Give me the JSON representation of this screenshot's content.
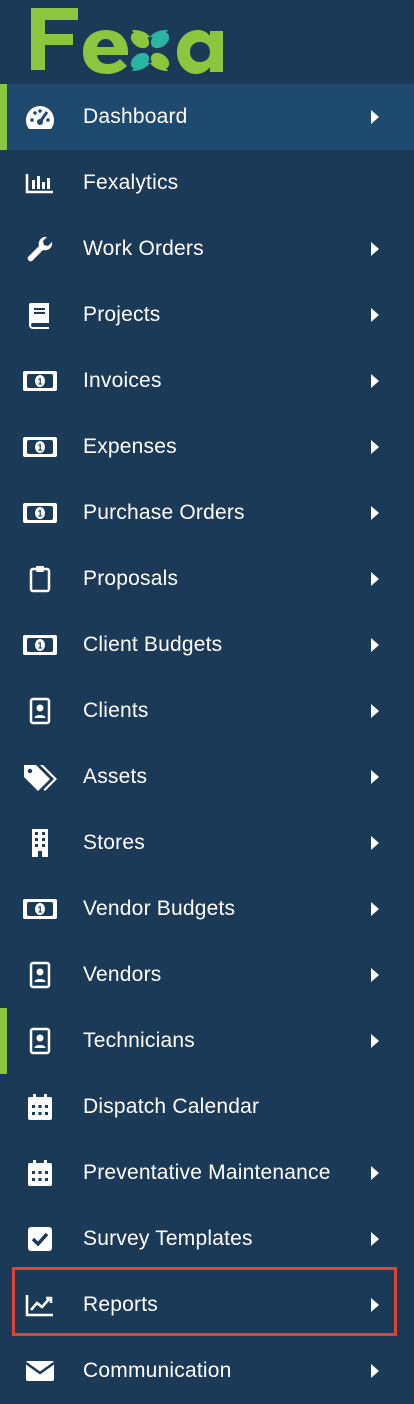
{
  "brand": {
    "name": "Fexa",
    "accent": "#8cc63f",
    "background": "#1b3a58",
    "active_background": "#1e4a70",
    "highlight": "#e0432f"
  },
  "menu": {
    "items": [
      {
        "label": "Dashboard",
        "icon": "dashboard-gauge-icon",
        "has_submenu": true
      },
      {
        "label": "Fexalytics",
        "icon": "bar-chart-icon",
        "has_submenu": false
      },
      {
        "label": "Work Orders",
        "icon": "wrench-icon",
        "has_submenu": true
      },
      {
        "label": "Projects",
        "icon": "book-icon",
        "has_submenu": true
      },
      {
        "label": "Invoices",
        "icon": "money-bill-icon",
        "has_submenu": true
      },
      {
        "label": "Expenses",
        "icon": "money-bill-icon",
        "has_submenu": true
      },
      {
        "label": "Purchase Orders",
        "icon": "money-bill-icon",
        "has_submenu": true
      },
      {
        "label": "Proposals",
        "icon": "clipboard-icon",
        "has_submenu": true
      },
      {
        "label": "Client Budgets",
        "icon": "money-bill-icon",
        "has_submenu": true
      },
      {
        "label": "Clients",
        "icon": "id-badge-icon",
        "has_submenu": true
      },
      {
        "label": "Assets",
        "icon": "tags-icon",
        "has_submenu": true
      },
      {
        "label": "Stores",
        "icon": "building-icon",
        "has_submenu": true
      },
      {
        "label": "Vendor Budgets",
        "icon": "money-bill-icon",
        "has_submenu": true
      },
      {
        "label": "Vendors",
        "icon": "id-badge-icon",
        "has_submenu": true
      },
      {
        "label": "Technicians",
        "icon": "id-badge-icon",
        "has_submenu": true
      },
      {
        "label": "Dispatch Calendar",
        "icon": "calendar-icon",
        "has_submenu": false
      },
      {
        "label": "Preventative Maintenance",
        "icon": "calendar-icon",
        "has_submenu": true
      },
      {
        "label": "Survey Templates",
        "icon": "check-square-icon",
        "has_submenu": true
      },
      {
        "label": "Reports",
        "icon": "line-chart-icon",
        "has_submenu": true
      },
      {
        "label": "Communication",
        "icon": "envelope-icon",
        "has_submenu": true
      }
    ]
  }
}
